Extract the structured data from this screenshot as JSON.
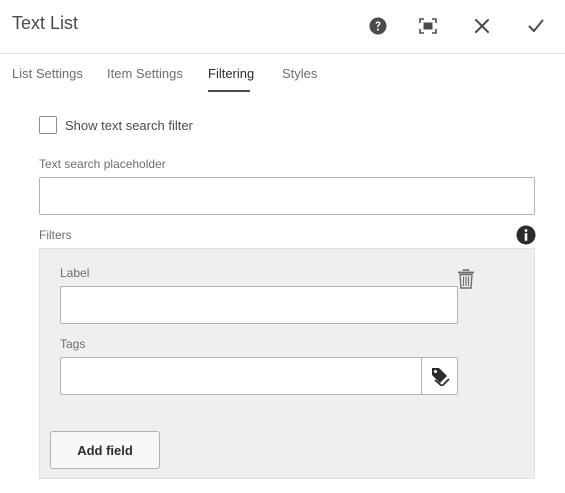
{
  "header": {
    "title": "Text List"
  },
  "tabs": [
    {
      "label": "List Settings"
    },
    {
      "label": "Item Settings"
    },
    {
      "label": "Filtering",
      "active": true
    },
    {
      "label": "Styles"
    }
  ],
  "filtering": {
    "show_search_label": "Show text search filter",
    "show_search_checked": false,
    "search_placeholder_label": "Text search placeholder",
    "search_placeholder_value": "",
    "filters_label": "Filters",
    "filter_item": {
      "label_label": "Label",
      "label_value": "",
      "tags_label": "Tags",
      "tags_value": ""
    },
    "add_field_label": "Add field"
  },
  "icons": {
    "help": "help-icon",
    "fullscreen": "fullscreen-icon",
    "close": "close-icon",
    "done": "checkmark-icon",
    "info": "info-icon",
    "delete": "trash-icon",
    "tags": "tag-icon"
  },
  "colors": {
    "panel_bg": "#efefef",
    "text": "#4b4b4b",
    "border": "#b3b3b3"
  }
}
